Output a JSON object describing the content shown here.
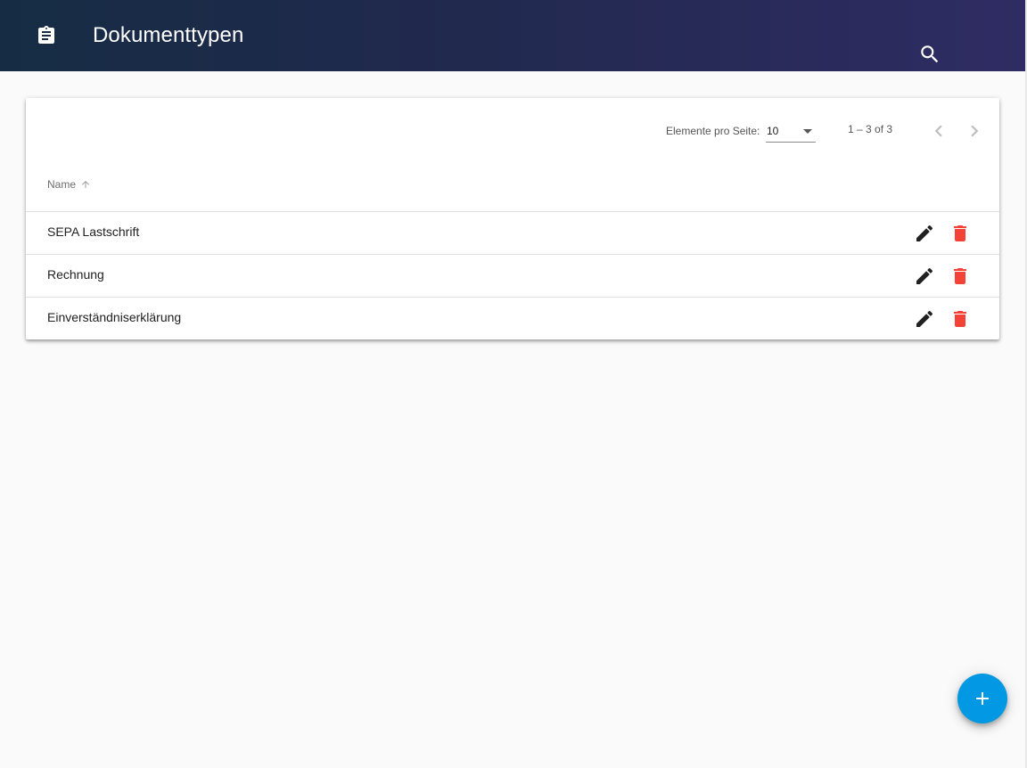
{
  "header": {
    "title": "Dokumenttypen",
    "app_icon": "assignment-icon",
    "search_icon": "search-icon"
  },
  "paginator": {
    "items_per_page_label": "Elemente pro Seite:",
    "items_per_page_value": "10",
    "range_label": "1 – 3 of 3",
    "prev_icon": "chevron-left-icon",
    "next_icon": "chevron-right-icon"
  },
  "table": {
    "columns": [
      {
        "label": "Name",
        "sort": "ascending"
      }
    ],
    "rows": [
      {
        "name": "SEPA Lastschrift"
      },
      {
        "name": "Rechnung"
      },
      {
        "name": "Einverständniserklärung"
      }
    ],
    "edit_icon": "pencil-icon",
    "delete_icon": "trash-icon",
    "delete_color": "#f44336"
  },
  "fab": {
    "icon": "plus-icon",
    "color": "#0398e4"
  }
}
